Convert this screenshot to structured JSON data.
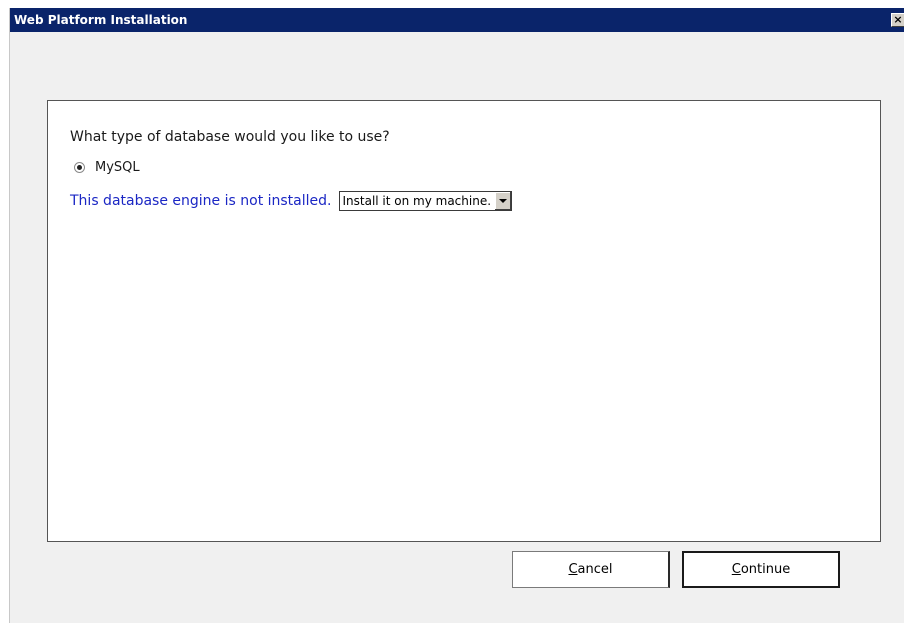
{
  "window": {
    "title": "Web Platform Installation",
    "close_glyph": "×"
  },
  "form": {
    "question": "What type of database would you like to use?",
    "radio_option": {
      "label": "MySQL",
      "selected": true
    },
    "engine_message": "This database engine is not installed.",
    "install_select": {
      "value": "Install it on my machine."
    }
  },
  "buttons": {
    "cancel": {
      "mnemonic": "C",
      "rest": "ancel"
    },
    "continue": {
      "mnemonic": "C",
      "rest": "ontinue"
    }
  },
  "colors": {
    "titlebar": "#0a246a",
    "engine_message": "#1b27c4",
    "background": "#f0f0f0"
  }
}
